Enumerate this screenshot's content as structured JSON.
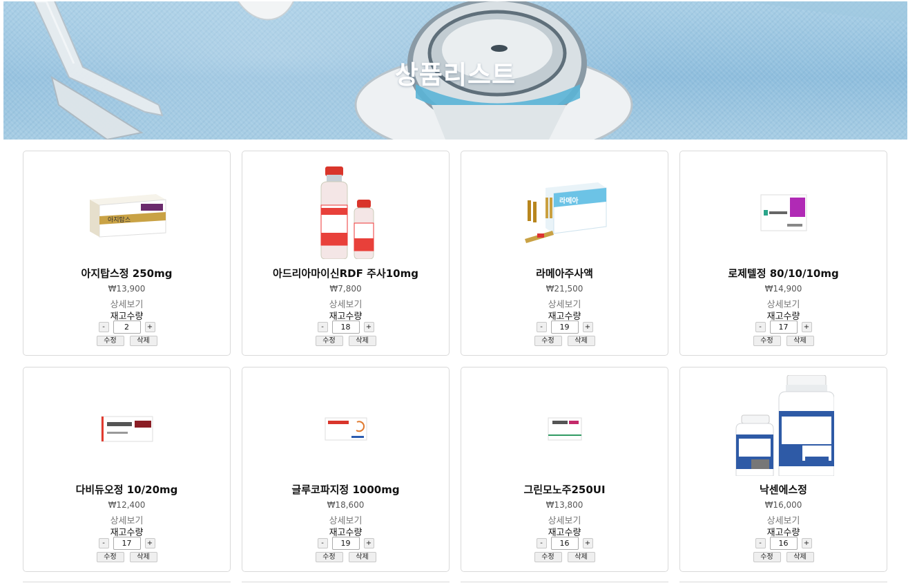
{
  "hero": {
    "title": "상품리스트"
  },
  "labels": {
    "detail": "상세보기",
    "stock": "재고수량",
    "minus": "-",
    "plus": "+",
    "edit": "수정",
    "delete": "삭제"
  },
  "colors": {
    "banner": "#8fbedd",
    "card_border": "#d9d9d9",
    "price_text": "#555555",
    "detail_text": "#777777"
  },
  "products": [
    {
      "name": "아지탑스정 250mg",
      "price": "₩13,900",
      "qty": "2",
      "image": "azithromycin-box-image"
    },
    {
      "name": "아드리아마이신RDF 주사10mg",
      "price": "₩7,800",
      "qty": "18",
      "image": "adriamycin-vials-image"
    },
    {
      "name": "라메아주사액",
      "price": "₩21,500",
      "qty": "19",
      "image": "ramea-ampoule-box-image"
    },
    {
      "name": "로제텔정 80/10/10mg",
      "price": "₩14,900",
      "qty": "17",
      "image": "rozetel-box-image"
    },
    {
      "name": "다비듀오정 10/20mg",
      "price": "₩12,400",
      "qty": "17",
      "image": "daviduo-box-image"
    },
    {
      "name": "글루코파지정 1000mg",
      "price": "₩18,600",
      "qty": "19",
      "image": "glucophage-box-image"
    },
    {
      "name": "그린모노주250UI",
      "price": "₩13,800",
      "qty": "16",
      "image": "greenmono-box-image"
    },
    {
      "name": "낙센에스정",
      "price": "₩16,000",
      "qty": "16",
      "image": "naxen-bottles-image"
    }
  ]
}
